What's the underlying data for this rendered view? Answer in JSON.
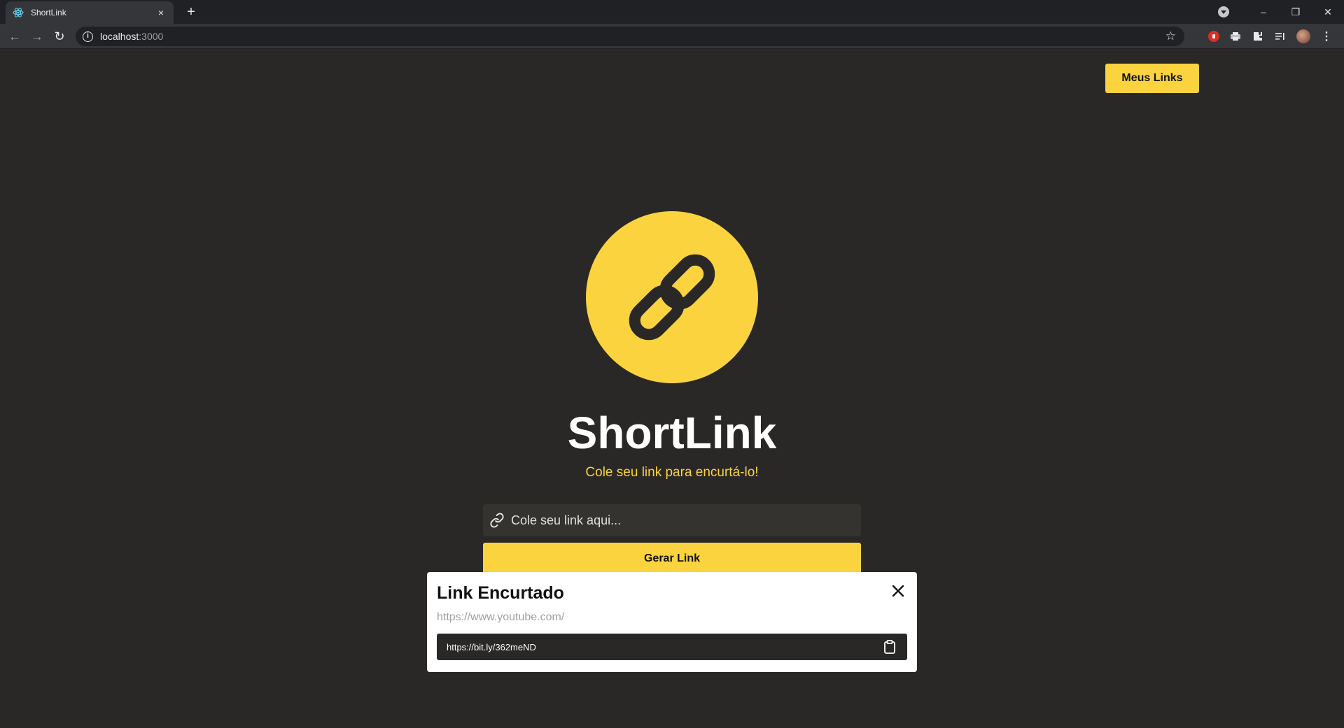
{
  "browser": {
    "tab_title": "ShortLink",
    "tab_close": "×",
    "new_tab": "+",
    "url_host": "localhost",
    "url_port": ":3000",
    "controls": {
      "minimize": "–",
      "restore": "❐",
      "close": "✕"
    }
  },
  "header": {
    "my_links_label": "Meus Links"
  },
  "hero": {
    "title": "ShortLink",
    "tagline": "Cole seu link para encurtá-lo!"
  },
  "form": {
    "input_placeholder": "Cole seu link aqui...",
    "input_value": "",
    "submit_label": "Gerar Link"
  },
  "modal": {
    "title": "Link Encurtado",
    "original_url": "https://www.youtube.com/",
    "short_url": "https://bit.ly/362meND"
  },
  "colors": {
    "accent": "#fad33e",
    "background": "#2a2826",
    "chrome": "#202124"
  },
  "icons": [
    "react-icon",
    "link-icon",
    "close-icon",
    "clipboard-icon",
    "star-icon",
    "extensions-icon"
  ]
}
